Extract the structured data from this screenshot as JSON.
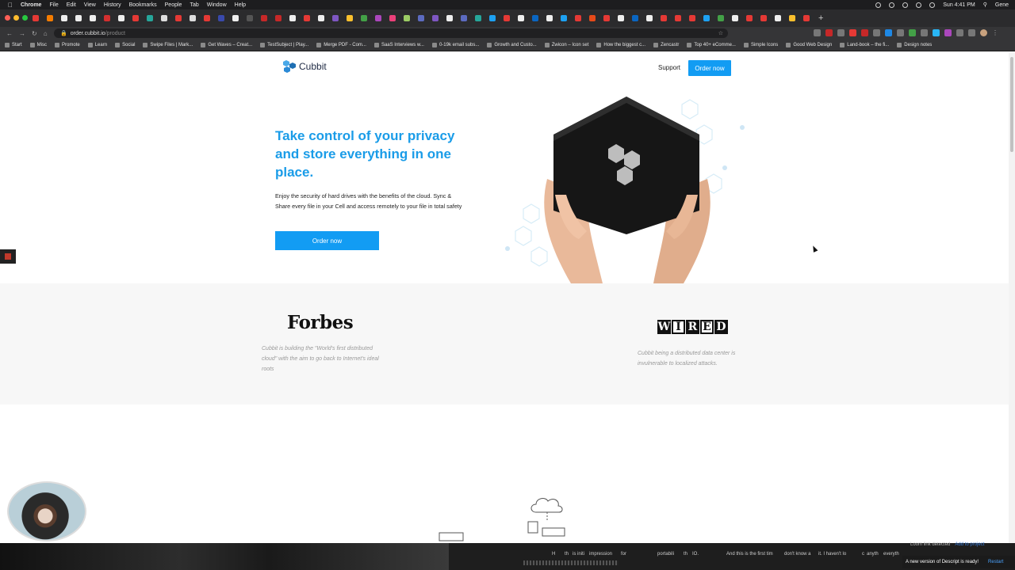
{
  "menubar": {
    "items": [
      "Chrome",
      "File",
      "Edit",
      "View",
      "History",
      "Bookmarks",
      "People",
      "Tab",
      "Window",
      "Help"
    ],
    "clock": "Sun 4:41 PM",
    "user": "Gene"
  },
  "address": {
    "domain": "order.cubbit.io",
    "path": "/product"
  },
  "bookmarks": [
    "Start",
    "Misc",
    "Promote",
    "Learn",
    "Social",
    "Swipe Files | Mark...",
    "Get Waves – Creat...",
    "TestSubject | Play...",
    "Merge PDF - Com...",
    "SaaS Interviews w...",
    "0-19k email subs...",
    "Growth and Custo...",
    "Zwicon – Icon set",
    "How the biggest c...",
    "Zencastr",
    "Top 40+ eComme...",
    "Simple Icons",
    "Good Web Design",
    "Land-book – the fi...",
    "Design notes"
  ],
  "site": {
    "logo_text": "Cubbit",
    "support": "Support",
    "order_top": "Order now",
    "hero_title": "Take control of your privacy and store everything in one place.",
    "hero_sub": "Enjoy the security of hard drives with the benefits of the cloud. Sync & Share every file in your Cell and access remotely to your file in total safety",
    "order_main": "Order now",
    "press": {
      "forbes_logo": "Forbes",
      "forbes_quote": "Cubbit is building the \"World's first distributed cloud\" with the aim to go back to Internet's ideal roots",
      "wired_letters": [
        "W",
        "I",
        "R",
        "E",
        "D"
      ],
      "wired_quote": "Cubbit being a distributed data center is invulnerable to localized attacks."
    }
  },
  "overlays": {
    "loom_text": "Loom link detected",
    "loom_add": "Add to project",
    "toast_text": "A new version of Descript is ready!",
    "toast_action": "Restart",
    "captions": [
      "H",
      "th",
      "is initi",
      "impression",
      "for",
      "portabili",
      "th",
      "IO.",
      "And this is the first tim",
      "don't know a",
      "it. I haven't lo",
      "c",
      "anyth",
      "everyth"
    ]
  },
  "colors": {
    "accent": "#129cf3",
    "title_blue": "#1a9ce8"
  }
}
